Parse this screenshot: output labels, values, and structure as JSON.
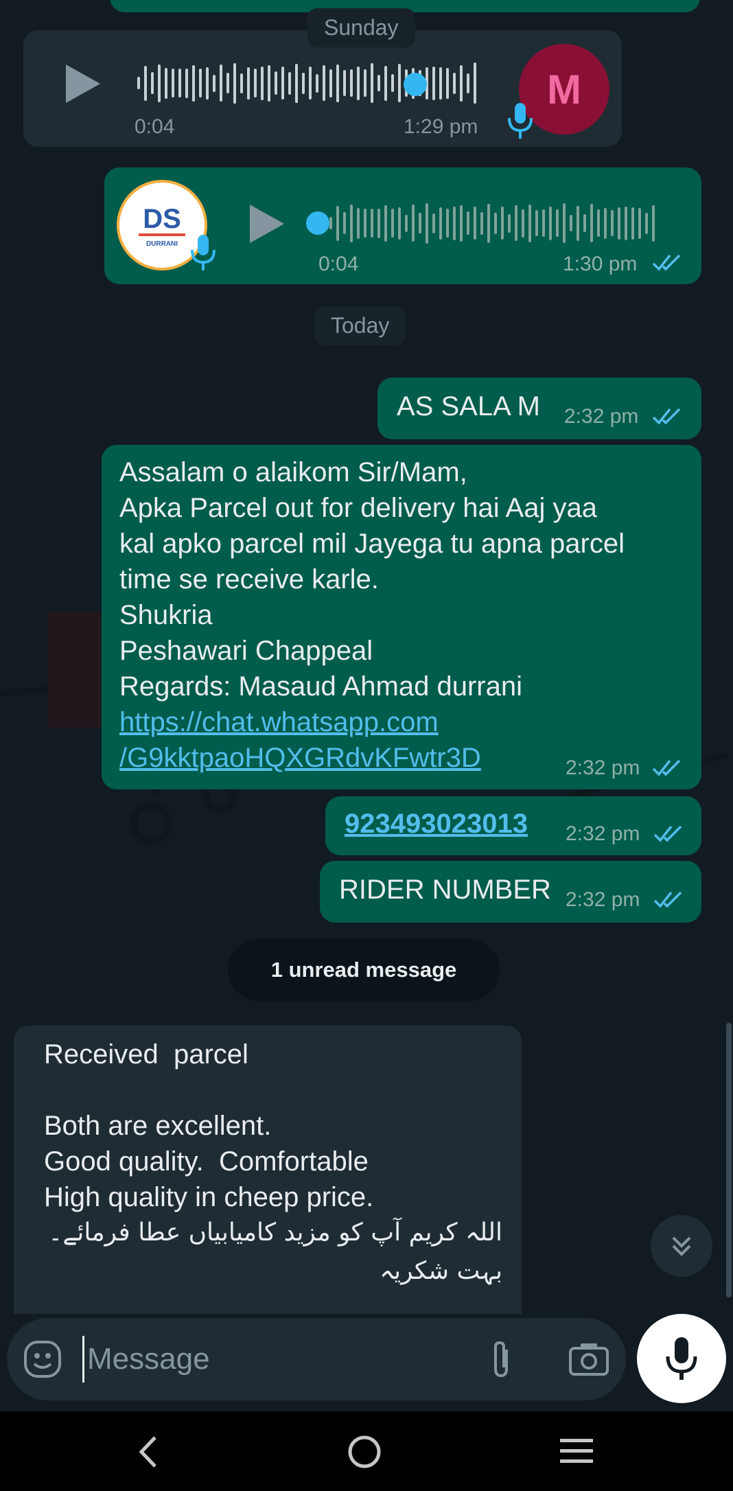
{
  "chat": {
    "date_sunday": "Sunday",
    "date_today": "Today",
    "voice_in": {
      "duration": "0:04",
      "time": "1:29 pm",
      "avatar_letter": "M"
    },
    "voice_out": {
      "duration": "0:04",
      "time": "1:30 pm",
      "logo_text": "DS",
      "logo_sub": "DURRANI"
    },
    "messages_out": [
      {
        "text": "AS SALA M",
        "time": "2:32 pm"
      },
      {
        "text": "Assalam o alaikom Sir/Mam,\nApka Parcel out for delivery hai Aaj yaa\nkal apko parcel mil Jayega tu apna parcel\ntime se receive karle.\nShukria\nPeshawari Chappeal\nRegards: Masaud Ahmad durrani",
        "link_line1": "https://chat.whatsapp.com",
        "link_line2": "/G9kktpaoHQXGRdvKFwtr3D",
        "time": "2:32 pm"
      },
      {
        "text": "923493023013",
        "time": "2:32 pm"
      },
      {
        "text": "RIDER NUMBER",
        "time": "2:32 pm"
      }
    ],
    "unread_banner": "1 unread message",
    "message_in": {
      "text": "Received  parcel\n\nBoth are excellent.\nGood quality.  Comfortable\nHigh quality in cheep price.",
      "urdu_line1": "اللہ کریم آپ کو مزید کامیابیاں عطا فرمائے۔",
      "urdu_line2": "بہت شکریہ"
    }
  },
  "composer": {
    "placeholder": "Message"
  },
  "colors": {
    "outgoing": "#005c4b",
    "incoming": "#1f2c34",
    "accent": "#53bdeb",
    "background": "#121b22"
  },
  "icons": [
    "emoji-icon",
    "attach-icon",
    "camera-icon",
    "mic-icon",
    "play-icon",
    "double-check-icon",
    "scroll-down-icon",
    "back-nav-icon",
    "home-nav-icon",
    "recents-nav-icon"
  ]
}
